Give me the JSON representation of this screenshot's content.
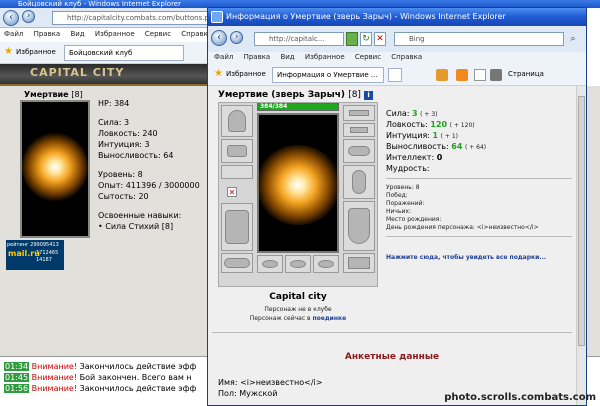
{
  "background": {
    "window_title": "Бойцовский клуб - Windows Internet Explorer",
    "address": "http://capitalcity.combats.com/buttons.pl?b",
    "menu": [
      "Файл",
      "Правка",
      "Вид",
      "Избранное",
      "Сервис",
      "Справка"
    ],
    "favorites_label": "Избранное",
    "tab_label": "Бойцовский клуб",
    "site_logo": "CAPITAL CITY",
    "character": {
      "name": "Умертвие",
      "level": "[8]",
      "hp": "HP: 384",
      "strength": "Сила: 3",
      "agility": "Ловкость: 240",
      "intuition": "Интуиция: 3",
      "endurance": "Выносливость: 64",
      "level_line": "Уровень: 8",
      "experience": "Опыт: 411396 / 3000000",
      "satiety": "Сытость: 20",
      "skills_title": "Освоенные навыки:",
      "skill_1": "Сила Стихий [8]"
    },
    "badge_top": "рейтинг 299095413",
    "badge_mail": "mail.ru",
    "badge_num1": "1712465",
    "badge_num2": "14187",
    "chat": [
      {
        "time": "01:34",
        "warn": "Внимание!",
        "text": "Закончилось действие эфф"
      },
      {
        "time": "01:45",
        "warn": "Внимание!",
        "text": "Бой закончен. Всего вам н"
      },
      {
        "time": "01:56",
        "warn": "Внимание!",
        "text": "Закончилось действие эфф"
      }
    ]
  },
  "popup": {
    "title": "Информация о Умертвие (зверь Зарыч) - Windows Internet Explorer",
    "address": "http://capitalc...",
    "search_placeholder": "Bing",
    "menu": [
      "Файл",
      "Правка",
      "Вид",
      "Избранное",
      "Сервис",
      "Справка"
    ],
    "favorites_label": "Избранное",
    "tab_label": "Информация о Умертвие ...",
    "page_menu": "Страница",
    "char_title": "Умертвие (зверь Зарыч)",
    "char_level": "[8]",
    "hp_text": "384/384",
    "hp_fraction": 1.0,
    "stats": {
      "strength_label": "Сила:",
      "strength_val": "3",
      "strength_bonus": "( + 3)",
      "agility_label": "Ловкость:",
      "agility_val": "120",
      "agility_bonus": "( + 120)",
      "intuition_label": "Интуиция:",
      "intuition_val": "1",
      "intuition_bonus": "( + 1)",
      "endurance_label": "Выносливость:",
      "endurance_val": "64",
      "endurance_bonus": "( + 64)",
      "intellect_label": "Интеллект:",
      "intellect_val": "0",
      "wisdom_label": "Мудрость:"
    },
    "info": {
      "level": "Уровень: 8",
      "wins": "Побед:",
      "losses": "Поражений:",
      "draws": "Ничьих:",
      "birthplace": "Место рождения:",
      "birthday": "День рождения персонажа: <i>неизвестно</i>"
    },
    "gifts_link": "Нажмите сюда, чтобы увидеть все подарки...",
    "city": "Capital city",
    "status_line_1": "Персонаж не в клубе",
    "status_line_2_prefix": "Персонаж сейчас в",
    "status_line_2_link": "поединке",
    "personal_title": "Анкетные данные",
    "name_line": "Имя: <i>неизвестно</i>",
    "gender_line": "Пол: Мужской"
  },
  "watermark": "photo.scrolls.combats.com"
}
